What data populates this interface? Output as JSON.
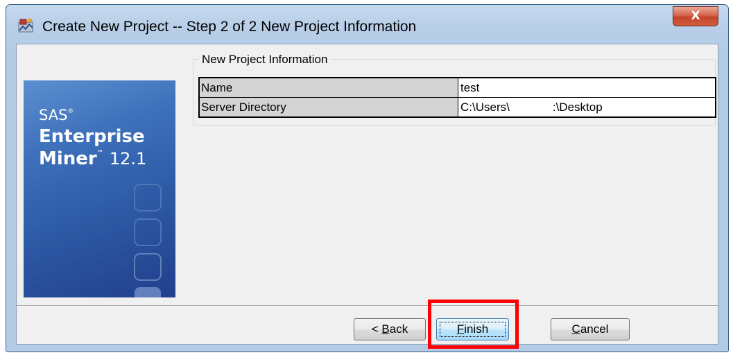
{
  "window": {
    "title": "Create New Project  -- Step 2 of 2  New Project Information",
    "close_label": "X"
  },
  "logo": {
    "line1": "SAS",
    "line2": "Enterprise",
    "line3": "Miner",
    "version": "12.1"
  },
  "group": {
    "title": "New Project Information"
  },
  "table": {
    "rows": [
      {
        "label": "Name",
        "value": "test"
      },
      {
        "label": "Server Directory",
        "value_prefix": "C:\\Users\\",
        "value_suffix": ":\\Desktop"
      }
    ]
  },
  "buttons": {
    "back_prefix": "< ",
    "back_mnemonic": "B",
    "back_rest": "ack",
    "finish_mnemonic": "F",
    "finish_rest": "inish",
    "cancel_mnemonic": "C",
    "cancel_rest": "ancel"
  },
  "colors": {
    "highlight": "#ff0000",
    "title_bar": "#c5d9ef",
    "logo_blue": "#2d5aa5"
  }
}
